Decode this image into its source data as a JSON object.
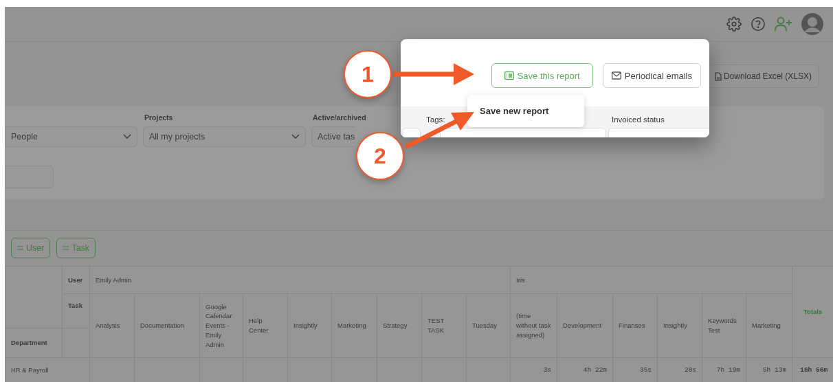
{
  "export_button": {
    "label": "Download Excel (XLSX)"
  },
  "filters": [
    {
      "value": "People"
    },
    {
      "label": "Projects",
      "value": "All my projects"
    },
    {
      "label": "Active/archived",
      "value": "Active tas"
    }
  ],
  "grouping_chips": [
    {
      "label": "User"
    },
    {
      "label": "Task"
    }
  ],
  "table": {
    "row_labels": {
      "user": "User",
      "task": "Task",
      "department": "Department"
    },
    "totals_header": "Totals",
    "users": [
      {
        "name": "Emily Admin",
        "tasks": [
          "Analysis",
          "Documentation",
          "Google Calendar Events - Emily Admin",
          "Help Center",
          "Insightly",
          "Marketing",
          "Strategy",
          "TEST TASK",
          "Tuesday"
        ]
      },
      {
        "name": "Iris",
        "tasks": [
          "(time without task assigned)",
          "Development",
          "Finanses",
          "Insightly",
          "Keywords Test",
          "Marketing"
        ]
      }
    ],
    "rows": [
      {
        "department": "HR & Payroll",
        "cells": [
          null,
          null,
          null,
          null,
          null,
          null,
          null,
          null,
          null,
          "3s",
          "4h 22m",
          "35s",
          "28s",
          "7h 19m",
          "5h 13m"
        ],
        "total": "16h 56m"
      }
    ]
  },
  "popup": {
    "buttons": [
      {
        "label": "Save this report",
        "kind": "list",
        "highlighted": true
      },
      {
        "label": "Periodical emails",
        "kind": "mail",
        "highlighted": false
      }
    ],
    "menu_items": [
      "Save new report"
    ],
    "field_labels": [
      "Tags:",
      "Invoiced status"
    ]
  },
  "callouts": [
    {
      "number": "1"
    },
    {
      "number": "2"
    }
  ]
}
